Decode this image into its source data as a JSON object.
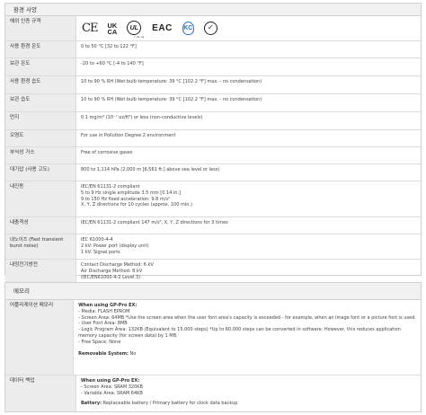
{
  "env": {
    "title": "환경 사양",
    "rows": [
      {
        "label": "해외 인증 규격",
        "type": "icons"
      },
      {
        "label": "사용 환경 온도",
        "lines": [
          "0 to 50 °C [32 to 122 °F]"
        ]
      },
      {
        "label": "보관 온도",
        "lines": [
          "-20 to +60 °C [-4 to 140 °F]"
        ]
      },
      {
        "label": "사용 환경 습도",
        "lines": [
          "10 to 90 % RH (Wet bulb temperature: 39 °C [102.2 °F] max. - no condensation)"
        ]
      },
      {
        "label": "보관 습도",
        "lines": [
          "10 to 90 % RH (Wet bulb temperature: 39 °C [102.2 °F] max. - no condensation)"
        ]
      },
      {
        "label": "먼지",
        "lines": [
          "0.1 mg/m³ (10⁻⁷ oz/ft³) or less (non-conductive levels)"
        ]
      },
      {
        "label": "오염도",
        "lines": [
          "For use in Pollution Degree 2 environment"
        ]
      },
      {
        "label": "부식성 가스",
        "lines": [
          "Free of corrosive gases"
        ]
      },
      {
        "label": "대기압 (사용 고도)",
        "lines": [
          "800 to 1,114 hPa (2,000 m [6,561 ft.] above sea level or less)"
        ]
      },
      {
        "label": "내진동",
        "lines": [
          "IEC/EN 61131-2 compliant",
          "5 to 9 Hz single amplitude 3.5 mm [0.14 in.]",
          "9 to 150 Hz fixed acceleration: 9.8 m/s²",
          "X, Y, Z directions for 10 cycles (approx. 100 min.)"
        ]
      },
      {
        "label": "내충격성",
        "lines": [
          "IEC/EN 61131-2 compliant 147 m/s², X, Y, Z directions for 3 times"
        ]
      },
      {
        "label": "내노이즈 (Fast transient burst noise)",
        "lines": [
          "IEC 61000-4-4",
          "2 kV: Power port (display unit)",
          "1 kV: Signal ports"
        ]
      },
      {
        "label": "내정전기방전",
        "lines": [
          "Contact Discharge Method: 6 kV",
          "Air Discharge Method: 8 kV",
          "(IEC/EN61000-4-2 Level 3)"
        ]
      }
    ],
    "cert_marks": [
      "CE",
      "UK",
      "CA",
      "UL",
      "c UL us",
      "EAC",
      "KC",
      "RCM"
    ]
  },
  "memory": {
    "title": "메모리",
    "app": {
      "label": "어플리케이션 메모리",
      "heading": "When using GP-Pro EX:",
      "lines": [
        "- Media: FLASH EPROM",
        "- Screen Area: 64MB *Use the screen area when the user font area's capacity is exceeded - for example, when an image font or a picture font is used.",
        "- User Font Area: 8MB",
        "- Logic Program Area: 132KB (Equivalent to 15,000 steps) *Up to 60,000 steps can be converted in software. However, this reduces application memory capacity (for screen data) by 1 MB.",
        "- Free Space: None"
      ],
      "removable_label": "Removable System:",
      "removable_value": " No"
    },
    "backup": {
      "label": "데이터 백업",
      "heading": "When using GP-Pro EX:",
      "lines": [
        "- Screen Area: SRAM 320KB",
        "- Variable Area: SRAM 64KB"
      ],
      "battery_label": "Battery:",
      "battery_value": " Replaceable battery / Primary battery for clock data backup"
    }
  }
}
